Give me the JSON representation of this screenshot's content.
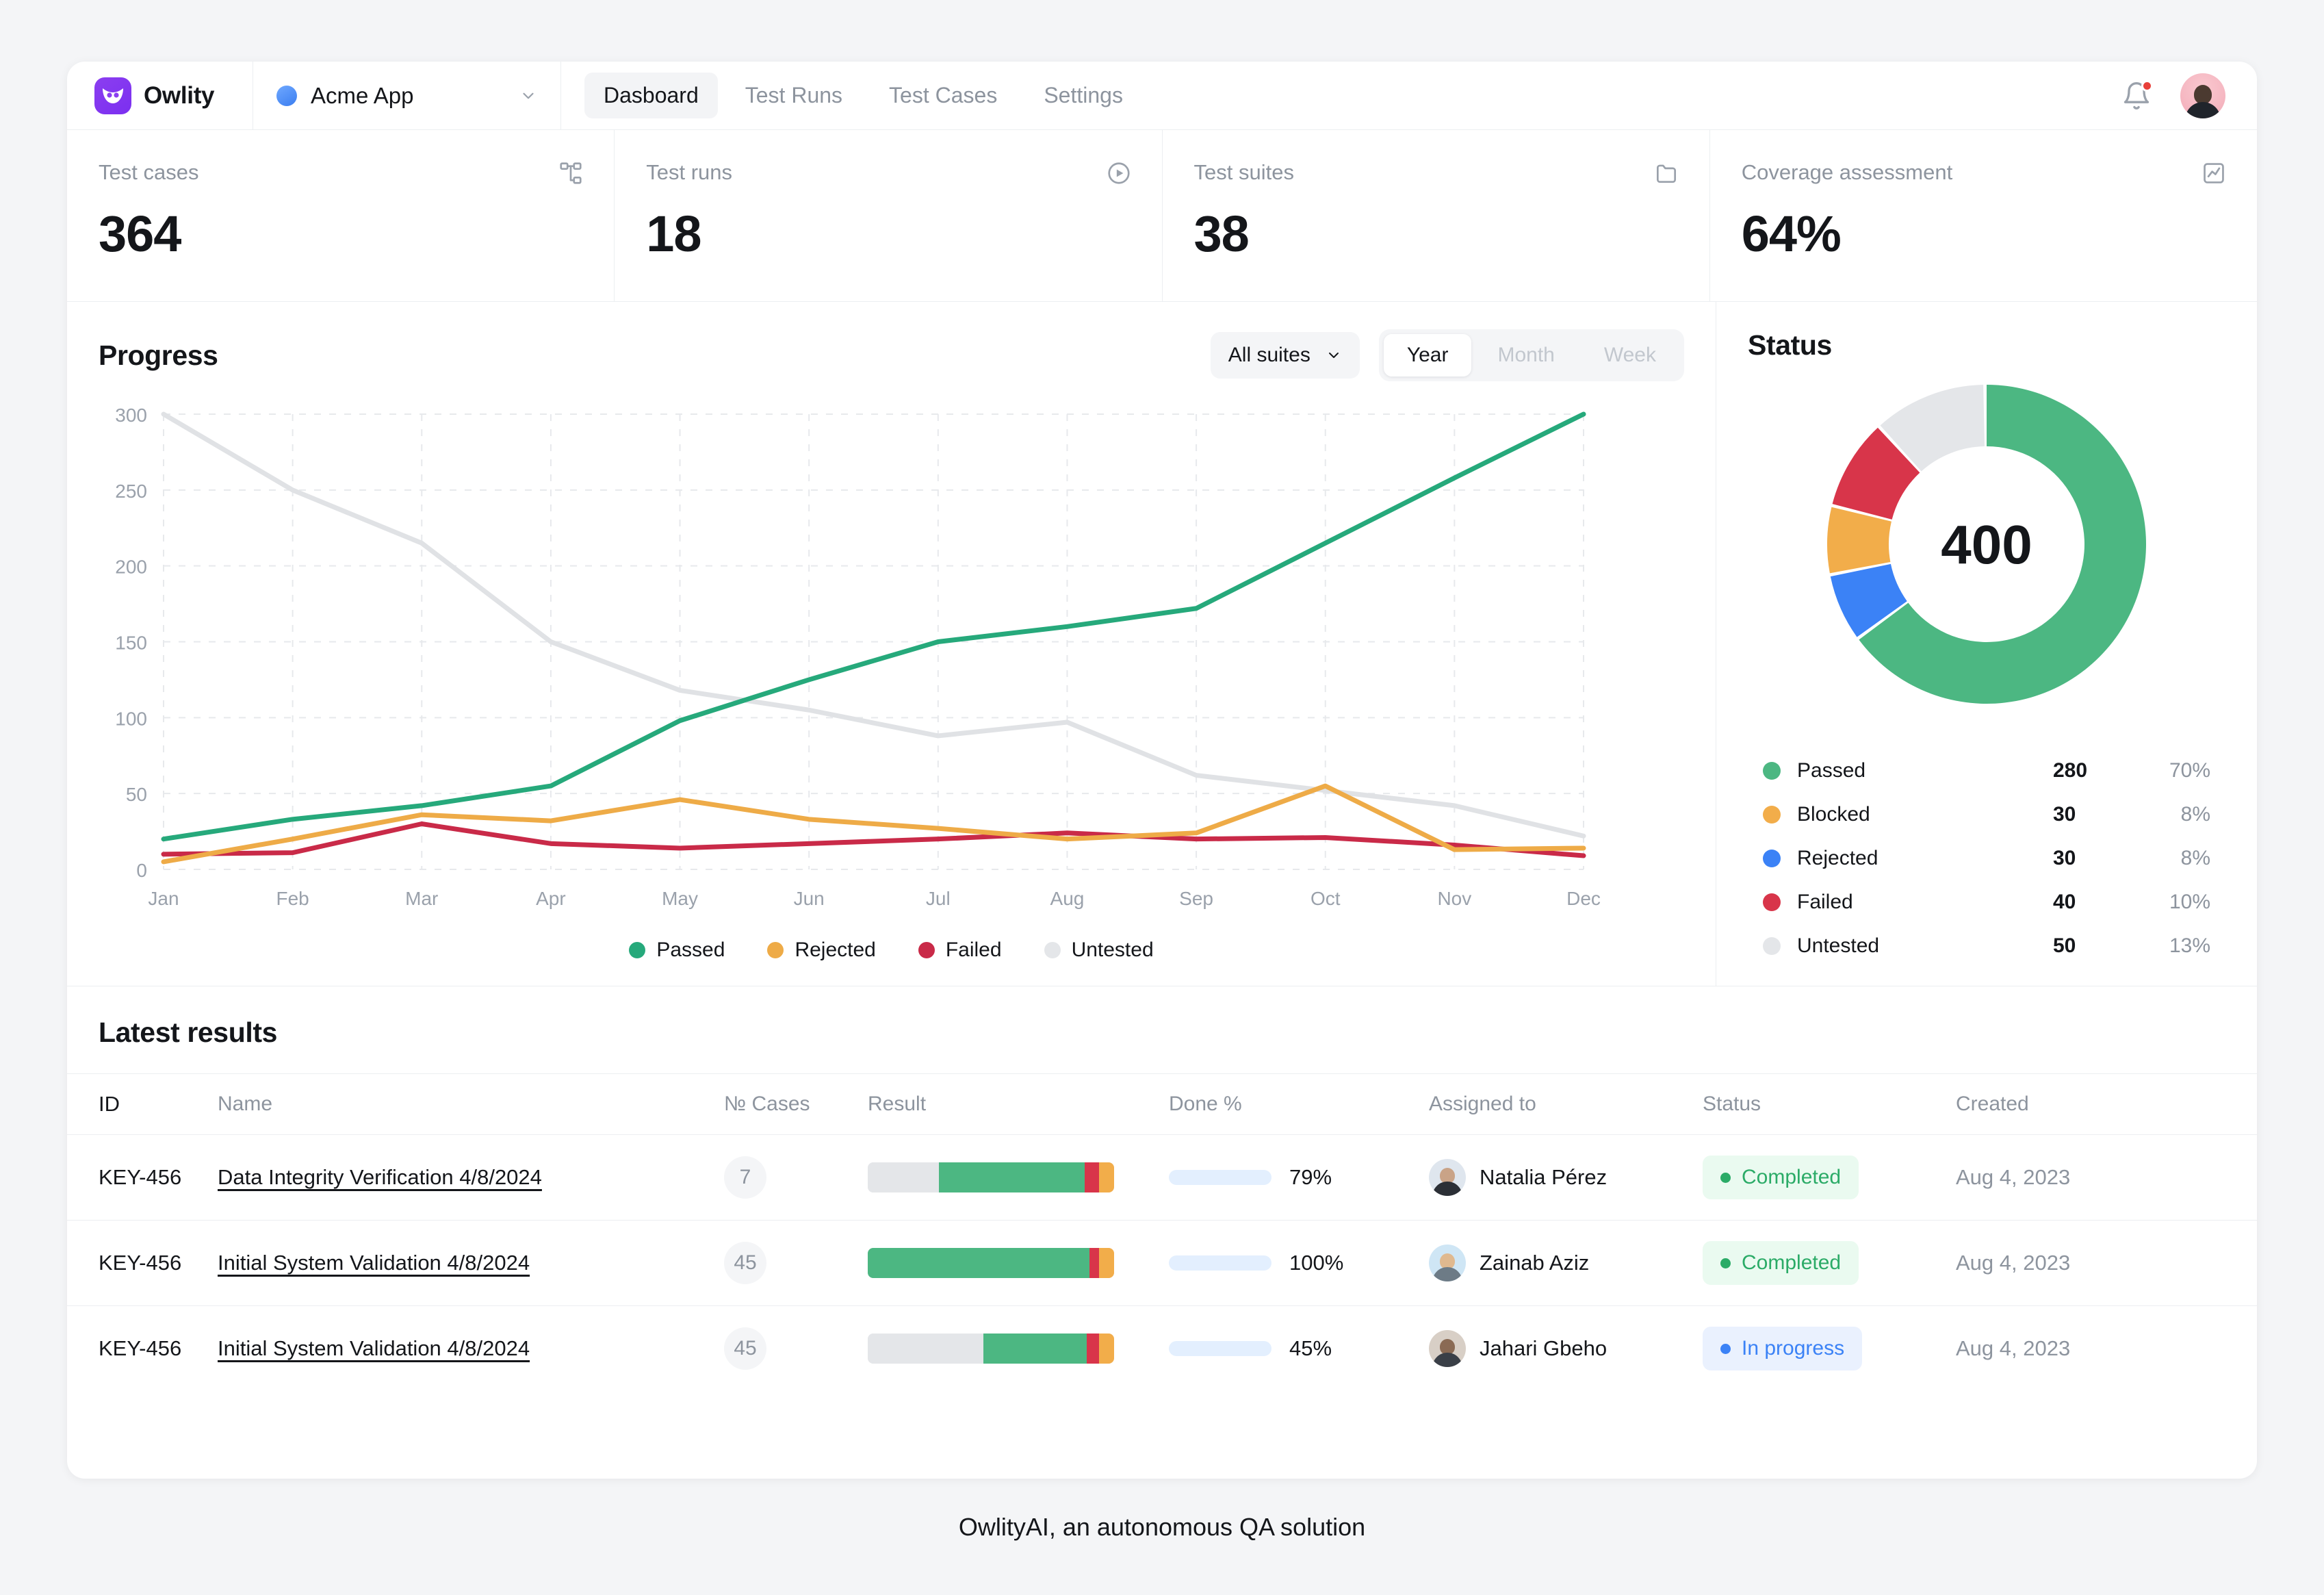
{
  "brand": {
    "name": "Owlity",
    "logo_icon": "owl-logo-icon"
  },
  "project": {
    "name": "Acme App",
    "chevron_icon": "chevron-down-icon"
  },
  "nav": {
    "tabs": [
      {
        "label": "Dasboard",
        "active": true
      },
      {
        "label": "Test Runs",
        "active": false
      },
      {
        "label": "Test Cases",
        "active": false
      },
      {
        "label": "Settings",
        "active": false
      }
    ]
  },
  "topbar_right": {
    "notifications_icon": "bell-icon",
    "has_unread": true,
    "avatar_icon": "user-avatar"
  },
  "kpis": [
    {
      "label": "Test cases",
      "value": "364",
      "icon": "sitemap-icon"
    },
    {
      "label": "Test runs",
      "value": "18",
      "icon": "play-circle-icon"
    },
    {
      "label": "Test suites",
      "value": "38",
      "icon": "folder-icon"
    },
    {
      "label": "Coverage assessment",
      "value": "64%",
      "icon": "chart-line-icon"
    }
  ],
  "progress": {
    "title": "Progress",
    "suite_filter": {
      "label": "All suites",
      "chevron_icon": "chevron-down-icon"
    },
    "range_segments": [
      {
        "label": "Year",
        "active": true
      },
      {
        "label": "Month",
        "active": false
      },
      {
        "label": "Week",
        "active": false
      }
    ]
  },
  "status": {
    "title": "Status",
    "total": "400",
    "legend": [
      {
        "name": "Passed",
        "count": "280",
        "pct": "70%",
        "color": "#4cb782"
      },
      {
        "name": "Blocked",
        "count": "30",
        "pct": "8%",
        "color": "#f2ad4a"
      },
      {
        "name": "Rejected",
        "count": "30",
        "pct": "8%",
        "color": "#3b82f6"
      },
      {
        "name": "Failed",
        "count": "40",
        "pct": "10%",
        "color": "#d8354a"
      },
      {
        "name": "Untested",
        "count": "50",
        "pct": "13%",
        "color": "#e4e6e9"
      }
    ]
  },
  "chart_data": [
    {
      "type": "line",
      "title": "Progress",
      "xlabel": "",
      "ylabel": "",
      "grid": true,
      "legend_position": "bottom",
      "ylim": [
        0,
        300
      ],
      "yticks": [
        0,
        50,
        100,
        150,
        200,
        250,
        300
      ],
      "categories": [
        "Jan",
        "Feb",
        "Mar",
        "Apr",
        "May",
        "Jun",
        "Jul",
        "Aug",
        "Sep",
        "Oct",
        "Nov",
        "Dec"
      ],
      "series": [
        {
          "name": "Passed",
          "color": "#26a97b",
          "values": [
            20,
            33,
            42,
            55,
            98,
            125,
            150,
            160,
            172,
            215,
            258,
            300
          ]
        },
        {
          "name": "Rejected",
          "color": "#eeab47",
          "values": [
            5,
            20,
            36,
            32,
            46,
            33,
            27,
            20,
            24,
            55,
            13,
            14
          ]
        },
        {
          "name": "Failed",
          "color": "#c92a48",
          "values": [
            10,
            11,
            30,
            17,
            14,
            17,
            20,
            24,
            20,
            21,
            16,
            9
          ]
        },
        {
          "name": "Untested",
          "color": "#e0e2e5",
          "values": [
            300,
            250,
            215,
            150,
            118,
            105,
            88,
            97,
            62,
            52,
            42,
            22
          ]
        }
      ]
    },
    {
      "type": "pie",
      "title": "Status",
      "center_label": "400",
      "labels": [
        "Passed",
        "Rejected",
        "Blocked",
        "Failed",
        "Untested"
      ],
      "values": [
        280,
        30,
        30,
        40,
        50
      ],
      "percents": [
        70,
        8,
        8,
        10,
        13
      ],
      "colors": [
        "#4cb782",
        "#3b82f6",
        "#f2ad4a",
        "#d8354a",
        "#e4e6e9"
      ]
    }
  ],
  "results": {
    "title": "Latest results",
    "columns": [
      "ID",
      "Name",
      "№ Cases",
      "Result",
      "Done %",
      "Assigned to",
      "Status",
      "Created"
    ],
    "rows": [
      {
        "id": "KEY-456",
        "name": "Data Integrity Verification 4/8/2024",
        "cases": "7",
        "result_segments": [
          {
            "name": "Untested",
            "pct": 29,
            "color": "#e4e6e9"
          },
          {
            "name": "Passed",
            "pct": 59,
            "color": "#4cb782"
          },
          {
            "name": "Failed",
            "pct": 6,
            "color": "#d8354a"
          },
          {
            "name": "Blocked",
            "pct": 6,
            "color": "#f2ad4a"
          }
        ],
        "done_pct": "79%",
        "done_value": 79,
        "assignee": "Natalia Pérez",
        "avatar_bg": "#dfe6ee",
        "avatar_skin": "#c9a387",
        "avatar_body": "#2b2f36",
        "status": "Completed",
        "status_kind": "completed",
        "created": "Aug 4, 2023"
      },
      {
        "id": "KEY-456",
        "name": "Initial System Validation 4/8/2024",
        "cases": "45",
        "result_segments": [
          {
            "name": "Passed",
            "pct": 90,
            "color": "#4cb782"
          },
          {
            "name": "Failed",
            "pct": 4,
            "color": "#d8354a"
          },
          {
            "name": "Blocked",
            "pct": 6,
            "color": "#f2ad4a"
          }
        ],
        "done_pct": "100%",
        "done_value": 100,
        "assignee": "Zainab Aziz",
        "avatar_bg": "#cfe6f5",
        "avatar_skin": "#e0b98f",
        "avatar_body": "#6d7b86",
        "status": "Completed",
        "status_kind": "completed",
        "created": "Aug 4, 2023"
      },
      {
        "id": "KEY-456",
        "name": "Initial System Validation 4/8/2024",
        "cases": "45",
        "result_segments": [
          {
            "name": "Untested",
            "pct": 47,
            "color": "#e4e6e9"
          },
          {
            "name": "Passed",
            "pct": 42,
            "color": "#4cb782"
          },
          {
            "name": "Failed",
            "pct": 5,
            "color": "#d8354a"
          },
          {
            "name": "Blocked",
            "pct": 6,
            "color": "#f2ad4a"
          }
        ],
        "done_pct": "45%",
        "done_value": 45,
        "assignee": "Jahari Gbeho",
        "avatar_bg": "#d8cfc6",
        "avatar_skin": "#8a6a54",
        "avatar_body": "#3a3f47",
        "status": "In progress",
        "status_kind": "inprogress",
        "created": "Aug 4, 2023"
      }
    ]
  },
  "footer": {
    "caption": "OwlityAI, an autonomous QA solution"
  }
}
